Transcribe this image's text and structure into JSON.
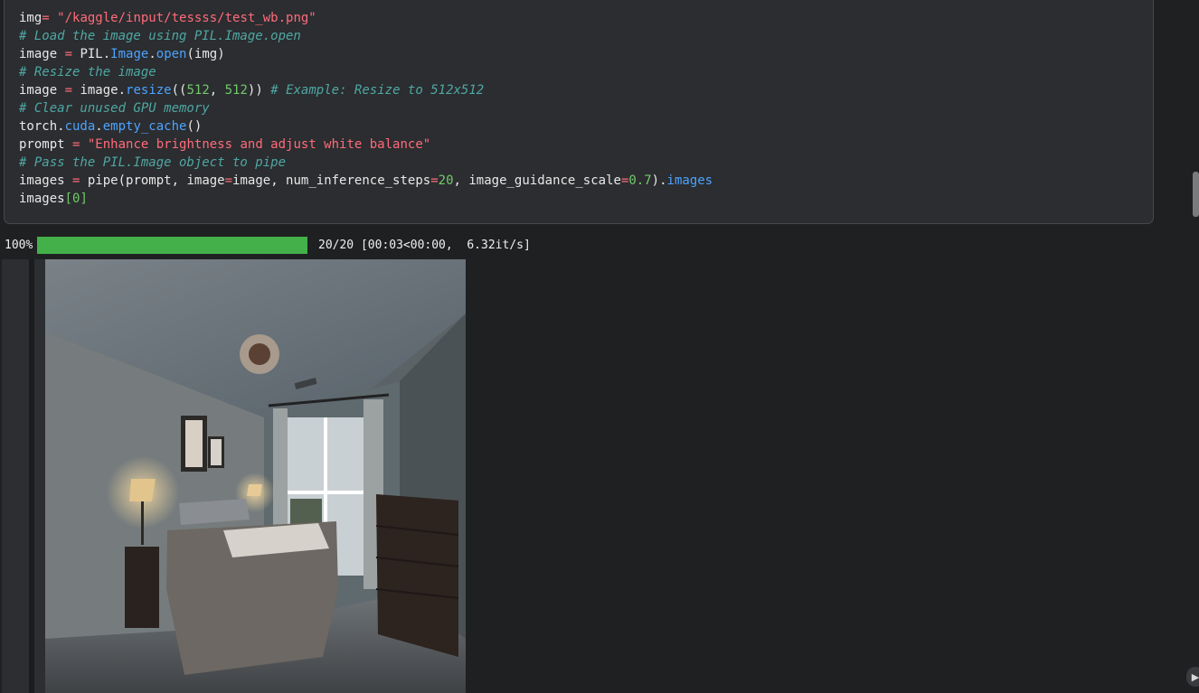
{
  "code_lines": [
    [
      {
        "t": "img",
        "c": "id"
      },
      {
        "t": "=",
        "c": "op"
      },
      {
        "t": " \"/kaggle/input/tessss/test_wb.png\"",
        "c": "str"
      }
    ],
    [
      {
        "t": "# Load the image using PIL.Image.open",
        "c": "cmt"
      }
    ],
    [
      {
        "t": "image ",
        "c": "id"
      },
      {
        "t": "=",
        "c": "op"
      },
      {
        "t": " PIL.",
        "c": "id"
      },
      {
        "t": "Image",
        "c": "fn"
      },
      {
        "t": ".",
        "c": "id"
      },
      {
        "t": "open",
        "c": "fn"
      },
      {
        "t": "(img)",
        "c": "id"
      }
    ],
    [
      {
        "t": "# Resize the image",
        "c": "cmt"
      }
    ],
    [
      {
        "t": "image ",
        "c": "id"
      },
      {
        "t": "=",
        "c": "op"
      },
      {
        "t": " image.",
        "c": "id"
      },
      {
        "t": "resize",
        "c": "fn"
      },
      {
        "t": "((",
        "c": "id"
      },
      {
        "t": "512",
        "c": "num"
      },
      {
        "t": ", ",
        "c": "id"
      },
      {
        "t": "512",
        "c": "num"
      },
      {
        "t": ")) ",
        "c": "id"
      },
      {
        "t": "# Example: Resize to 512x512",
        "c": "cmt"
      }
    ],
    [
      {
        "t": "# Clear unused GPU memory",
        "c": "cmt"
      }
    ],
    [
      {
        "t": "torch.",
        "c": "id"
      },
      {
        "t": "cuda",
        "c": "fn"
      },
      {
        "t": ".",
        "c": "id"
      },
      {
        "t": "empty_cache",
        "c": "fn"
      },
      {
        "t": "()",
        "c": "id"
      }
    ],
    [
      {
        "t": "prompt ",
        "c": "id"
      },
      {
        "t": "=",
        "c": "op"
      },
      {
        "t": " \"Enhance brightness and adjust white balance\"",
        "c": "str"
      }
    ],
    [
      {
        "t": "# Pass the PIL.Image object to pipe",
        "c": "cmt"
      }
    ],
    [
      {
        "t": "images ",
        "c": "id"
      },
      {
        "t": "=",
        "c": "op"
      },
      {
        "t": " pipe(prompt, image",
        "c": "id"
      },
      {
        "t": "=",
        "c": "op"
      },
      {
        "t": "image, num_inference_steps",
        "c": "id"
      },
      {
        "t": "=",
        "c": "op"
      },
      {
        "t": "20",
        "c": "num"
      },
      {
        "t": ", image_guidance_scale",
        "c": "id"
      },
      {
        "t": "=",
        "c": "op"
      },
      {
        "t": "0.7",
        "c": "num"
      },
      {
        "t": ").",
        "c": "id"
      },
      {
        "t": "images",
        "c": "fn"
      }
    ],
    [
      {
        "t": "images",
        "c": "id"
      },
      {
        "t": "[",
        "c": "brk"
      },
      {
        "t": "0",
        "c": "num"
      },
      {
        "t": "]",
        "c": "brk"
      }
    ]
  ],
  "progress": {
    "percent_label": "100%",
    "fraction": 1.0,
    "status": "20/20 [00:03<00:00,  6.32it/s]"
  },
  "output_image_alt": "",
  "corner_button_icon": "▶"
}
